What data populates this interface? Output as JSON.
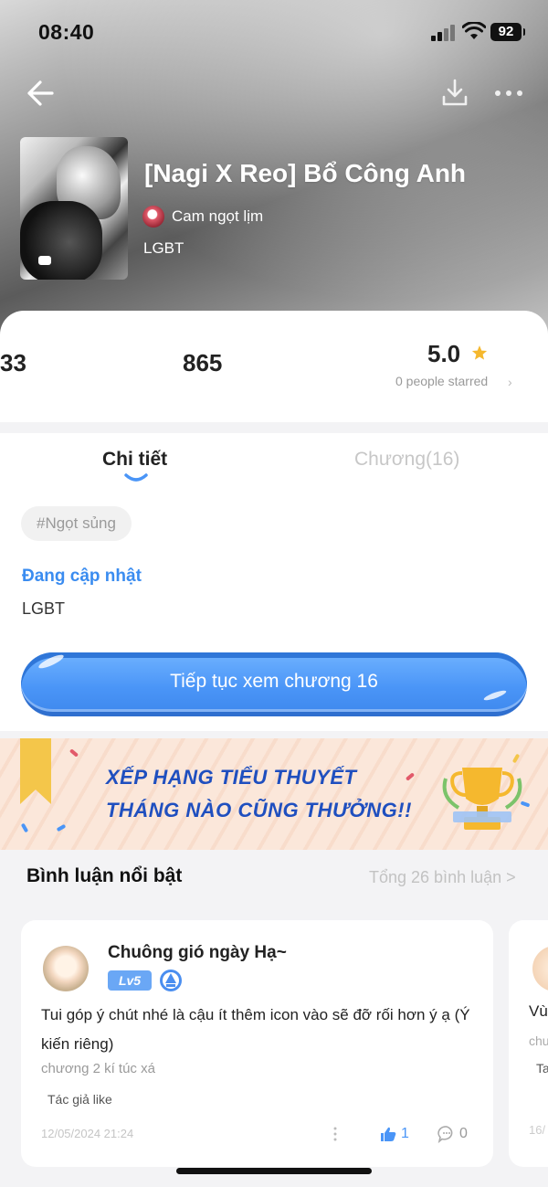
{
  "status_bar": {
    "time": "08:40",
    "battery": "92"
  },
  "book": {
    "title": "[Nagi X Reo] Bổ Công Anh",
    "author": "Cam ngọt lịm",
    "genre": "LGBT"
  },
  "stats": {
    "stat_a": "33",
    "stat_b": "865",
    "rating": "5.0",
    "starred_text": "0 people starred",
    "starred_chevron": "›"
  },
  "tabs": [
    {
      "label": "Chi tiết",
      "active": true
    },
    {
      "label": "Chương(16)",
      "active": false
    }
  ],
  "details": {
    "tag": "#Ngọt sủng",
    "status": "Đang cập nhật",
    "genre": "LGBT",
    "continue_label": "Tiếp tục xem chương 16"
  },
  "banner": {
    "line1": "XẾP HẠNG TIỂU THUYẾT",
    "line2": "THÁNG NÀO CŨNG THƯỞNG!!"
  },
  "comments": {
    "title": "Bình luận nổi bật",
    "total": "Tổng 26 bình luận >",
    "items": [
      {
        "username": "Chuông gió ngày Hạ~",
        "level": "Lv5",
        "text": "Tui góp ý chút nhé là cậu ít thêm icon vào sẽ đỡ rối hơn ý ạ (Ý kiến riêng)",
        "chapter": "chương 2 kí túc xá",
        "author_like": "Tác giả like",
        "date": "12/05/2024 21:24",
        "likes": "1",
        "replies": "0"
      },
      {
        "text_fragment": "Vù",
        "chapter_fragment": "chư",
        "author_like_fragment": "Ta",
        "date_fragment": "16/"
      }
    ]
  },
  "colors": {
    "accent": "#3a8cf0",
    "button": "#4a95f7",
    "star": "#f5b82e",
    "banner_text": "#1f4fbf"
  },
  "icons": [
    "back-arrow-icon",
    "download-icon",
    "more-dots-icon",
    "star-icon",
    "trophy-icon",
    "thumbs-up-icon",
    "comment-bubble-icon",
    "rank-diamond-icon"
  ]
}
